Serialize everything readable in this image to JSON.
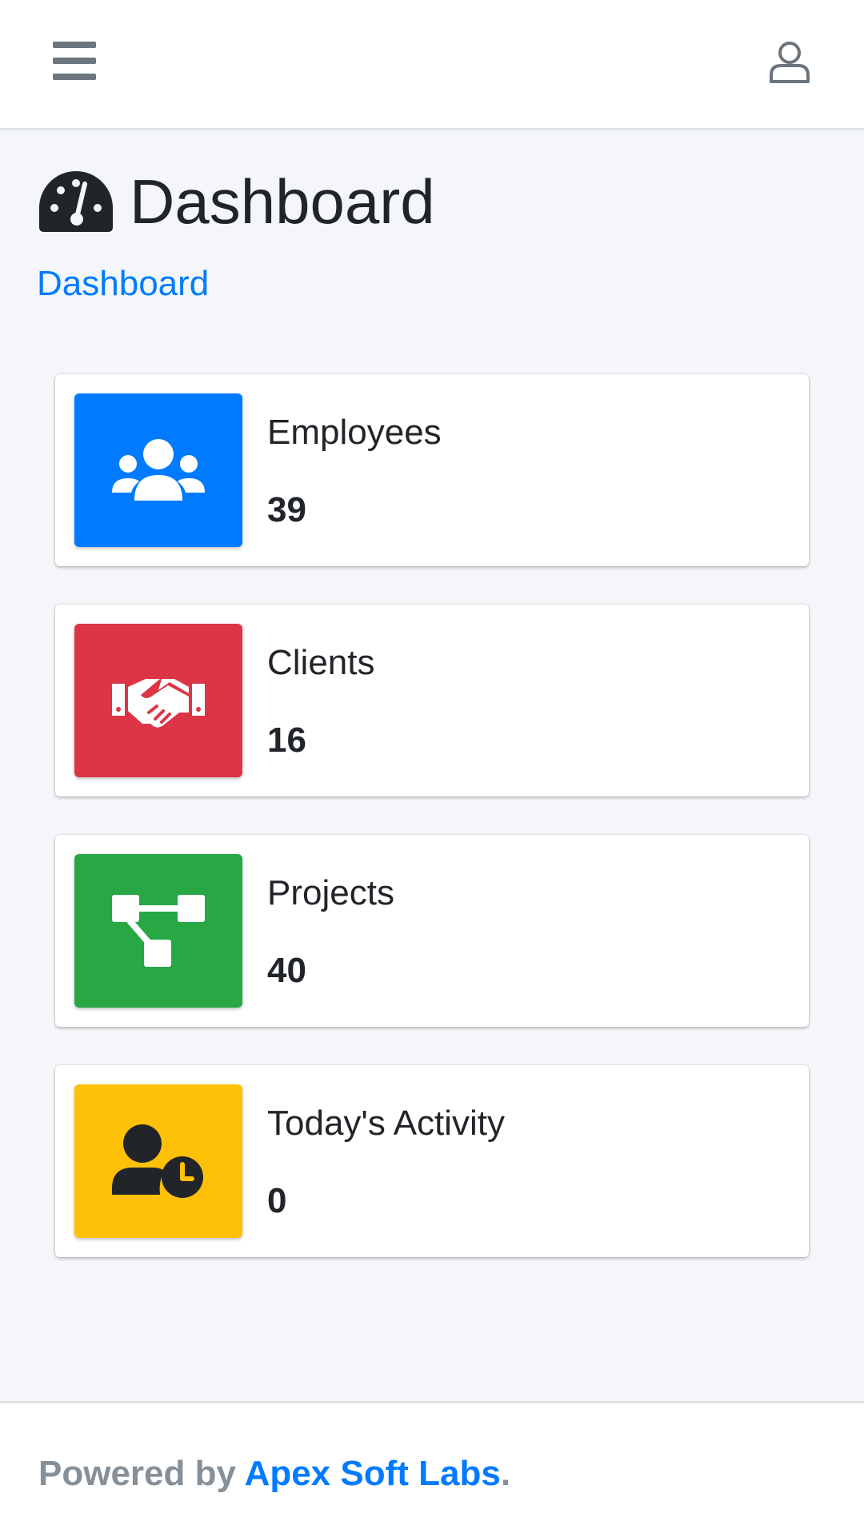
{
  "page": {
    "title": "Dashboard",
    "breadcrumb": "Dashboard"
  },
  "navbar": {
    "menu_icon": "bars-icon",
    "user_icon": "user-icon"
  },
  "colors": {
    "primary": "#007bff",
    "danger": "#dc3545",
    "success": "#28a745",
    "warning": "#ffc107"
  },
  "stats": [
    {
      "label": "Employees",
      "value": "39",
      "icon": "users-icon",
      "color": "#007bff"
    },
    {
      "label": "Clients",
      "value": "16",
      "icon": "handshake-icon",
      "color": "#dc3545"
    },
    {
      "label": "Projects",
      "value": "40",
      "icon": "project-diagram-icon",
      "color": "#28a745"
    },
    {
      "label": "Today's Activity",
      "value": "0",
      "icon": "user-clock-icon",
      "color": "#ffc107"
    }
  ],
  "footer": {
    "prefix": "Powered by ",
    "link": "Apex Soft Labs",
    "suffix": "."
  }
}
